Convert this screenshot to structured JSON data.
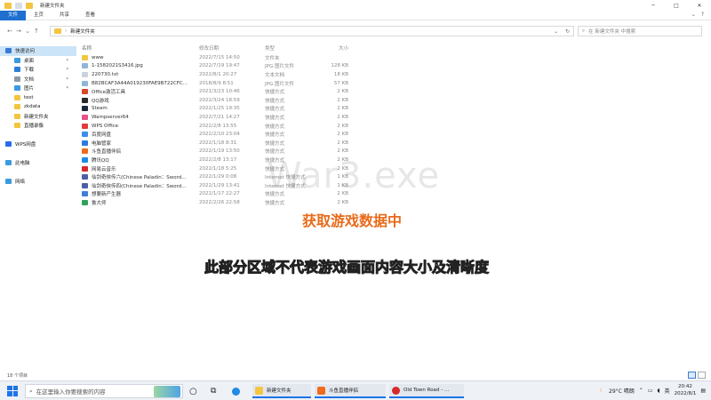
{
  "window": {
    "title": "新建文件夹",
    "controls": [
      "─",
      "□",
      "✕"
    ]
  },
  "ribbon": {
    "tabs": [
      "文件",
      "主页",
      "共享",
      "查看"
    ],
    "right_icons": [
      "chevron-down",
      "help"
    ]
  },
  "nav": {
    "back": "←",
    "forward": "→",
    "up_history": "⌄",
    "up": "↑",
    "address": "新建文件夹",
    "address_sep": "›",
    "search_placeholder": "在 新建文件夹 中搜索"
  },
  "sidebar": {
    "items": [
      {
        "label": "快速访问",
        "icon": "star-icon",
        "color": "#3a7bd5",
        "active": true,
        "pinned": false
      },
      {
        "label": "桌面",
        "icon": "desktop-icon",
        "color": "#3a9be0",
        "active": false,
        "pinned": true
      },
      {
        "label": "下载",
        "icon": "download-icon",
        "color": "#2d7fd5",
        "active": false,
        "pinned": true
      },
      {
        "label": "文档",
        "icon": "document-icon",
        "color": "#8d9aa8",
        "active": false,
        "pinned": true
      },
      {
        "label": "图片",
        "icon": "pictures-icon",
        "color": "#3a9be0",
        "active": false,
        "pinned": true
      },
      {
        "label": "test",
        "icon": "folder-icon",
        "color": "#f4c542",
        "active": false,
        "pinned": false
      },
      {
        "label": "zkdata",
        "icon": "folder-icon",
        "color": "#f4c542",
        "active": false,
        "pinned": false
      },
      {
        "label": "新建文件夹",
        "icon": "folder-icon",
        "color": "#f4c542",
        "active": false,
        "pinned": false
      },
      {
        "label": "直播录像",
        "icon": "folder-icon",
        "color": "#f4c542",
        "active": false,
        "pinned": false
      },
      {
        "label": "",
        "icon": "",
        "color": "",
        "active": false,
        "pinned": false
      },
      {
        "label": "WPS网盘",
        "icon": "cloud-icon",
        "color": "#2b6be6",
        "active": false,
        "pinned": false
      },
      {
        "label": "",
        "icon": "",
        "color": "",
        "active": false,
        "pinned": false
      },
      {
        "label": "此电脑",
        "icon": "computer-icon",
        "color": "#3a9be0",
        "active": false,
        "pinned": false
      },
      {
        "label": "",
        "icon": "",
        "color": "",
        "active": false,
        "pinned": false
      },
      {
        "label": "网络",
        "icon": "network-icon",
        "color": "#3a9be0",
        "active": false,
        "pinned": false
      }
    ],
    "pin_glyph": "✶"
  },
  "files": {
    "headers": {
      "name": "名称",
      "date": "修改日期",
      "type": "类型",
      "size": "大小"
    },
    "rows": [
      {
        "name": "www",
        "date": "2022/7/15 14:50",
        "type": "文件夹",
        "size": "",
        "icon": "folder-icon",
        "color": "#f4c542"
      },
      {
        "name": "1-1582021S3416.jpg",
        "date": "2022/7/19 19:47",
        "type": "JPG 图片文件",
        "size": "128 KB",
        "icon": "image-icon",
        "color": "#8fb6d9"
      },
      {
        "name": "220730.txt",
        "date": "2022/8/1 20:27",
        "type": "文本文档",
        "size": "18 KB",
        "icon": "text-file-icon",
        "color": "#c9d3dd"
      },
      {
        "name": "B82BCAF3A44A019230FAE9B722CFC...",
        "date": "2018/8/9 8:51",
        "type": "JPG 图片文件",
        "size": "57 KB",
        "icon": "image-icon",
        "color": "#8fb6d9"
      },
      {
        "name": "Office激活工具",
        "date": "2021/3/23 10:46",
        "type": "快捷方式",
        "size": "2 KB",
        "icon": "office-icon",
        "color": "#d9472b"
      },
      {
        "name": "QQ游戏",
        "date": "2022/3/24 18:59",
        "type": "快捷方式",
        "size": "2 KB",
        "icon": "qq-icon",
        "color": "#2a2a2a"
      },
      {
        "name": "Steam",
        "date": "2022/1/25 19:35",
        "type": "快捷方式",
        "size": "2 KB",
        "icon": "steam-icon",
        "color": "#1b2838"
      },
      {
        "name": "Wampserver64",
        "date": "2022/7/21 14:27",
        "type": "快捷方式",
        "size": "2 KB",
        "icon": "wamp-icon",
        "color": "#e7508a"
      },
      {
        "name": "WPS Office",
        "date": "2022/2/8 13:55",
        "type": "快捷方式",
        "size": "2 KB",
        "icon": "wps-icon",
        "color": "#e23b3b"
      },
      {
        "name": "百度网盘",
        "date": "2022/2/10 23:04",
        "type": "快捷方式",
        "size": "2 KB",
        "icon": "baidu-icon",
        "color": "#3b8de8"
      },
      {
        "name": "电脑管家",
        "date": "2022/1/18 8:31",
        "type": "快捷方式",
        "size": "2 KB",
        "icon": "guard-icon",
        "color": "#2b78e4"
      },
      {
        "name": "斗鱼直播伴侣",
        "date": "2022/1/19 13:50",
        "type": "快捷方式",
        "size": "2 KB",
        "icon": "douyu-icon",
        "color": "#f06a1a"
      },
      {
        "name": "腾讯QQ",
        "date": "2022/2/8 13:17",
        "type": "快捷方式",
        "size": "2 KB",
        "icon": "qq-icon",
        "color": "#1e8ae6"
      },
      {
        "name": "网易云音乐",
        "date": "2022/1/18 5:25",
        "type": "快捷方式",
        "size": "2 KB",
        "icon": "music-icon",
        "color": "#d62a2a"
      },
      {
        "name": "仙剑奇侠传六(Chinese Paladin：Sword...",
        "date": "2022/1/29 0:08",
        "type": "Internet 快捷方式",
        "size": "1 KB",
        "icon": "game-icon",
        "color": "#4b5fa8"
      },
      {
        "name": "仙剑奇侠传四(Chinese Paladin：Sword...",
        "date": "2022/1/29 13:41",
        "type": "Internet 快捷方式",
        "size": "1 KB",
        "icon": "game-icon",
        "color": "#4b5fa8"
      },
      {
        "name": "想要新产生器",
        "date": "2022/1/17 22:27",
        "type": "快捷方式",
        "size": "2 KB",
        "icon": "app-icon",
        "color": "#3f7fd6"
      },
      {
        "name": "鲁大师",
        "date": "2022/2/26 22:58",
        "type": "快捷方式",
        "size": "2 KB",
        "icon": "ludashi-icon",
        "color": "#2fa35a"
      }
    ]
  },
  "overlay": {
    "watermark": "War3.exe",
    "caption_orange": "获取游戏数据中",
    "caption_white": "此部分区域不代表游戏画面内容大小及清晰度"
  },
  "status": {
    "count": "18 个项目"
  },
  "taskbar": {
    "search_placeholder": "在这里输入你要搜索的内容",
    "apps": [
      {
        "label": "新建文件夹",
        "color": "#f4c542"
      },
      {
        "label": "斗鱼直播伴侣",
        "color": "#f06a1a"
      },
      {
        "label": "Old Town Road - ...",
        "color": "#d62a2a"
      }
    ],
    "weather": "29°C 晴朗",
    "ime": "英",
    "time": "20:42",
    "date": "2022/8/1"
  }
}
